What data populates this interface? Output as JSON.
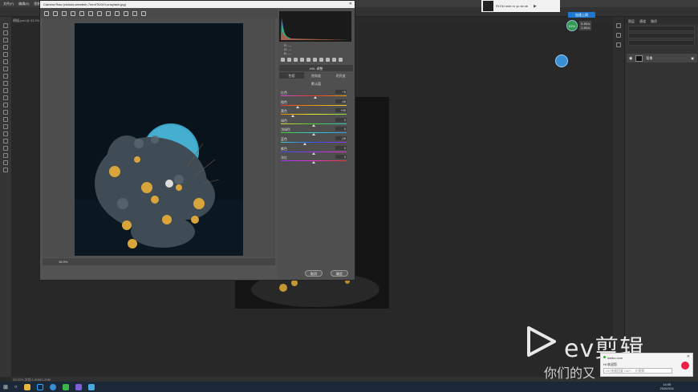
{
  "ps": {
    "menu": [
      "文件(F)",
      "编辑(E)",
      "图像(I)",
      "图层(L)",
      "文字(Y)",
      "选择(S)",
      "滤镜(T)",
      "3D(D)",
      "视图(V)",
      "窗口(W)",
      "帮助(H)"
    ],
    "doc_tab": "横幅.psd @ 33.3% (背景, RGB/8#)",
    "status": "33.33%    文档:1.83M/1.83M",
    "layers_tabs": [
      "图层",
      "通道",
      "路径"
    ],
    "layer_name": "背景"
  },
  "camera_raw": {
    "title": "Camera Raw (victoria-wendish-7mrr4TsXtXI-unsplash.jpg)",
    "zoom": "16.9%",
    "rgb_readout": [
      "R:  ---",
      "G:  ---",
      "B:  ---"
    ],
    "panel_title": "HSL 调整",
    "hsl_tabs": [
      "色相",
      "饱和度",
      "明亮度"
    ],
    "hsl_active_index": 0,
    "subheading": "默认值",
    "sliders": [
      {
        "label": "红色",
        "value": "+6",
        "pos": 0.53
      },
      {
        "label": "橙色",
        "value": "-48",
        "pos": 0.26
      },
      {
        "label": "黄色",
        "value": "+95",
        "pos": 0.18
      },
      {
        "label": "绿色",
        "value": "0",
        "pos": 0.5
      },
      {
        "label": "浅绿色",
        "value": "0",
        "pos": 0.5
      },
      {
        "label": "蓝色",
        "value": "-26",
        "pos": 0.37
      },
      {
        "label": "紫色",
        "value": "0",
        "pos": 0.5
      },
      {
        "label": "洋红",
        "value": "0",
        "pos": 0.5
      }
    ],
    "cancel": "取消",
    "ok": "确定"
  },
  "overlays": {
    "music_text": "Rt Eki mde ro yc sb sb",
    "net_label": "加速上网",
    "net_speed": [
      "0.4K/s",
      "1.4K/s"
    ],
    "net_pct": "51%",
    "ev_text": "ev剪辑",
    "ev_sub": "你们的又",
    "toast_title": "weibo.com",
    "toast_body": "Hi 欢迎您",
    "toast_input": "Hi! 快速回复 Ctrl+... 大视频"
  },
  "taskbar": {
    "time": "14:05",
    "date": "2020/3/11"
  },
  "colors": {
    "ps_bg": "#282828",
    "dialog_bg": "#535353",
    "accent_blue": "#3a8fd4"
  }
}
